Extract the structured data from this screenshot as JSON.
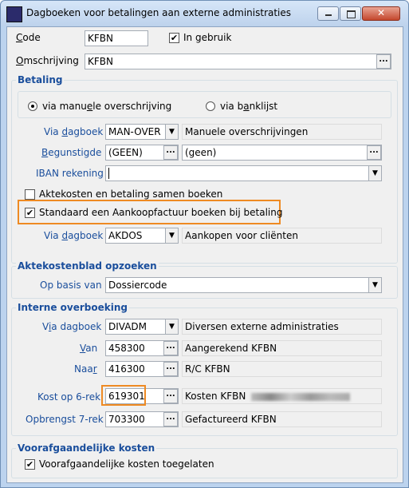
{
  "window": {
    "title": "Dagboeken voor betalingen aan externe administraties"
  },
  "header": {
    "code_label": "Code",
    "code_value": "KFBN",
    "in_gebruik_label": "In gebruik",
    "in_gebruik_checked": true,
    "omschrijving_label": "Omschrijving",
    "omschrijving_value": "KFBN"
  },
  "betaling": {
    "title": "Betaling",
    "radio_manual": "via manuele overschrijving",
    "radio_banklijst": "via banklijst",
    "selected": "manual",
    "via_dagboek_label": "Via dagboek",
    "via_dagboek_value": "MAN-OVER",
    "via_dagboek_desc": "Manuele overschrijvingen",
    "begunstigde_label": "Begunstigde",
    "begunstigde_value": "(GEEN)",
    "begunstigde_desc": "(geen)",
    "iban_label": "IBAN rekening",
    "iban_value": "",
    "aktekosten_label": "Aktekosten en betaling samen boeken",
    "aktekosten_checked": false,
    "standaard_label": "Standaard een Aankoopfactuur boeken bij betaling",
    "standaard_checked": true,
    "via_dagboek2_label": "Via dagboek",
    "via_dagboek2_value": "AKDOS",
    "via_dagboek2_desc": "Aankopen voor cliënten"
  },
  "aktekostenblad": {
    "title": "Aktekostenblad opzoeken",
    "op_basis_label": "Op basis van",
    "op_basis_value": "Dossiercode"
  },
  "interne": {
    "title": "Interne overboeking",
    "via_dagboek_label": "Via dagboek",
    "via_dagboek_value": "DIVADM",
    "via_dagboek_desc": "Diversen externe administraties",
    "van_label": "Van",
    "van_value": "458300",
    "van_desc": "Aangerekend KFBN",
    "naar_label": "Naar",
    "naar_value": "416300",
    "naar_desc": "R/C KFBN",
    "kost_label": "Kost op 6-rek",
    "kost_value": "619301",
    "kost_desc": "Kosten KFBN",
    "opbrengst_label": "Opbrengst 7-rek",
    "opbrengst_value": "703300",
    "opbrengst_desc": "Gefactureerd KFBN"
  },
  "voorafgaandelijk": {
    "title": "Voorafgaandelijke kosten",
    "toegelaten_label": "Voorafgaandelijke kosten toegelaten",
    "toegelaten_checked": true
  },
  "icons": {
    "ellipsis": "...",
    "dropdown": "▼",
    "check": "✔"
  },
  "colors": {
    "label_blue": "#1a4e9c",
    "highlight": "#ee8a23"
  }
}
